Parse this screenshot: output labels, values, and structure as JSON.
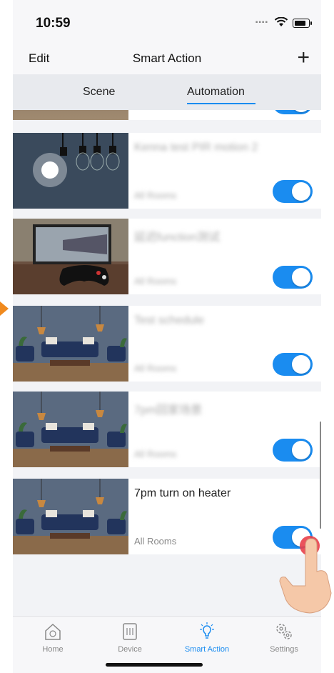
{
  "status": {
    "time": "10:59"
  },
  "nav": {
    "edit": "Edit",
    "title": "Smart Action",
    "add": "+"
  },
  "tabs": {
    "scene": "Scene",
    "automation": "Automation",
    "active": "Automation"
  },
  "automations": [
    {
      "title": "Kenna test PIR motion 2",
      "room": "All Rooms",
      "enabled": true,
      "image": "lightbulbs-image",
      "blurred": true
    },
    {
      "title": "延迟function测试",
      "room": "All Rooms",
      "enabled": true,
      "image": "gaming-desk-image",
      "blurred": true
    },
    {
      "title": "Test schedule",
      "room": "All Rooms",
      "enabled": true,
      "image": "living-room-image",
      "blurred": true
    },
    {
      "title": "7pm回家场景",
      "room": "All Rooms",
      "enabled": true,
      "image": "living-room-image",
      "blurred": true
    },
    {
      "title": "7pm turn on heater",
      "room": "All Rooms",
      "enabled": true,
      "image": "living-room-image",
      "blurred": false
    }
  ],
  "tabbar": [
    {
      "label": "Home",
      "icon": "home-icon"
    },
    {
      "label": "Device",
      "icon": "device-icon"
    },
    {
      "label": "Smart Action",
      "icon": "smart-action-icon"
    },
    {
      "label": "Settings",
      "icon": "settings-icon"
    }
  ],
  "colors": {
    "accent": "#1a8cf0",
    "marker": "#f08a1e"
  }
}
